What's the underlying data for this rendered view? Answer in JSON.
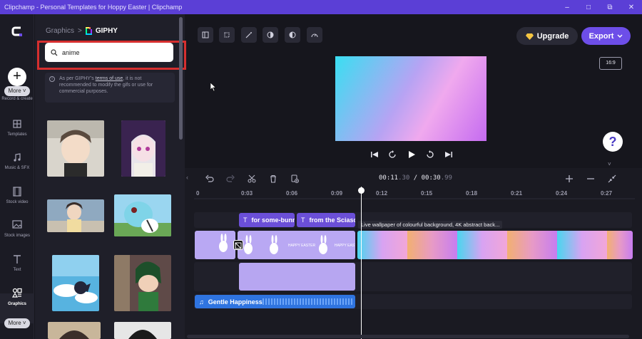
{
  "window": {
    "title": "Clipchamp - Personal Templates for Hoppy Easter | Clipchamp",
    "minimize_glyph": "–",
    "restore_glyph": "□",
    "maximize_glyph": "⧉",
    "close_glyph": "✕"
  },
  "rail": {
    "add_glyph": "+",
    "more_top": "More ˅",
    "record_label": "Record & create",
    "more_bottom": "More ˅",
    "items": [
      {
        "label": "Templates",
        "icon": "templates-icon"
      },
      {
        "label": "Music & SFX",
        "icon": "music-icon"
      },
      {
        "label": "Stock video",
        "icon": "film-icon"
      },
      {
        "label": "Stock images",
        "icon": "image-icon"
      },
      {
        "label": "Text",
        "icon": "text-icon"
      },
      {
        "label": "Graphics",
        "icon": "shapes-icon"
      }
    ],
    "active_item": "Graphics"
  },
  "panel": {
    "crumb_parent": "Graphics",
    "crumb_separator": ">",
    "crumb_current": "GIPHY",
    "search_value": "anime",
    "notice_prefix": "As per GIPHY's ",
    "notice_link": "terms of use",
    "notice_suffix": ", it is not recommended to modify the gifs or use for commercial purposes."
  },
  "topbar": {
    "upgrade_label": "Upgrade",
    "export_label": "Export",
    "aspect_ratio": "16:9",
    "help_glyph": "?",
    "collapse_glyph": "˅"
  },
  "timeline": {
    "current_time": "00:11",
    "current_frac": ".30",
    "separator": " / ",
    "total_time": "00:30",
    "total_frac": ".99",
    "ticks": [
      "0",
      "0:03",
      "0:06",
      "0:09",
      "0:12",
      "0:15",
      "0:18",
      "0:21",
      "0:24",
      "0:27"
    ],
    "text_clips": [
      {
        "glyph": "T",
        "label": "for some-bunny special"
      },
      {
        "glyph": "T",
        "label": "from the Sciascio family"
      }
    ],
    "video_clip_label": "Live wallpaper of colourful background, 4K abstract back...",
    "audio_clip_label": "Gentle Happiness",
    "audio_glyph": "♫",
    "easter_text": "HAPPY EASTER"
  },
  "colors": {
    "titlebar": "#5b3fd6",
    "accent": "#6d4ee8",
    "search_highlight": "#d62f2f",
    "audio": "#2f74e0"
  }
}
